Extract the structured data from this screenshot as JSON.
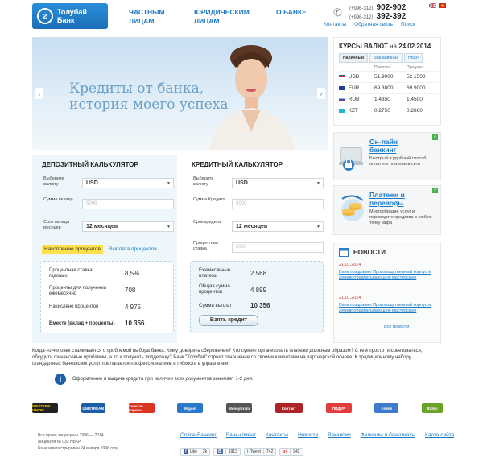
{
  "brand": {
    "name_line1": "Толубай",
    "name_line2": "Банк",
    "emblem": "coin-icon"
  },
  "topnav": [
    {
      "l1": "ЧАСТНЫМ",
      "l2": "ЛИЦАМ"
    },
    {
      "l1": "ЮРИДИЧЕСКИМ",
      "l2": "ЛИЦАМ"
    },
    {
      "l1": "О БАНКЕ",
      "l2": ""
    }
  ],
  "phones": [
    {
      "code": "(+996-312)",
      "number": "902-902"
    },
    {
      "code": "(+996-312)",
      "number": "392-392"
    }
  ],
  "toplinks": [
    "Контакты",
    "Обратная связь",
    "Поиск"
  ],
  "banner": {
    "line1": "Кредиты от банка,",
    "line2": "история моего успеха",
    "prev": "‹",
    "next": "›"
  },
  "rates": {
    "title": "КУРСЫ ВАЛЮТ",
    "date_prefix": "на",
    "date": "24.02.2014",
    "tabs": [
      "Наличный",
      "Безналичный",
      "НБКР"
    ],
    "headers": [
      "",
      "Покупка",
      "Продажа"
    ],
    "rows": [
      {
        "cur": "USD",
        "buy": "51.9000",
        "sell": "52.1500",
        "color": "#3a5fa8"
      },
      {
        "cur": "EUR",
        "buy": "69.3000",
        "sell": "69.9000",
        "color": "#1f3fa0"
      },
      {
        "cur": "RUB",
        "buy": "1.4350",
        "sell": "1.4500",
        "color": "#d22"
      },
      {
        "cur": "KZT",
        "buy": "0.2750",
        "sell": "0.2860",
        "color": "#29b0d8"
      }
    ]
  },
  "cards": [
    {
      "title1": "Он-лайн",
      "title2": "банкинг",
      "desc": "Быстрый и удобный способ оплатить платежи в сети"
    },
    {
      "title1": "Платежи и",
      "title2": "переводы",
      "desc": "Многообразие услуг и переводите средства в любую точку мира"
    }
  ],
  "news": {
    "title": "НОВОСТИ",
    "items": [
      {
        "date": "21.01.2014",
        "text": "Банк поздравил Производственный корпус и деревообрабатывающую мастерскую"
      },
      {
        "date": "21.01.2014",
        "text": "Банк поздравил Производственный корпус и деревообрабатывающую мастерскую"
      }
    ],
    "all": "Все новости"
  },
  "deposit": {
    "title": "ДЕПОЗИТНЫЙ КАЛЬКУЛЯТОР",
    "currency_label": "Выберите валюту",
    "currency": "USD",
    "amount_label": "Сумма вклада",
    "amount_placeholder": "5000",
    "term_label": "Срок вклада месяцев",
    "term": "12 месяцев",
    "tab_active": "Накопление процентов",
    "tab_other": "Выплата процентов",
    "results": [
      {
        "label": "Процентная ставка годовых",
        "value": "8,5%"
      },
      {
        "label": "Проценты для получения ежемесячно",
        "value": "708"
      },
      {
        "label": "Начислено процентов",
        "value": "4 975"
      },
      {
        "label": "Вместе (вклад + проценты)",
        "value": "10 356"
      }
    ]
  },
  "credit": {
    "title": "КРЕДИТНЫЙ КАЛЬКУЛЯТОР",
    "currency_label": "Выберите валюту",
    "currency": "USD",
    "amount_label": "Сумма Кредита",
    "amount_placeholder": "5000",
    "term_label": "Срок кредита",
    "term": "12 месяцев",
    "rate_label": "Процентная ставка",
    "rate_placeholder": "5000",
    "results": [
      {
        "label": "Ежемесячные платежи",
        "value": "2 568"
      },
      {
        "label": "Общая сумма процентов",
        "value": "4 899"
      },
      {
        "label": "Сумма выплат",
        "value": "10 356"
      }
    ],
    "button": "Взять кредит"
  },
  "about": "Когда-то человек сталкивается с проблемой выбора банка. Кому доверить сбережения? Кто сумеет организовать платежи должным образом? С кем просто посоветоваться, обсудить финансовые проблемы, а то и получить поддержку? Банк \"Толубай\" строит отношения со своими клиентами на партнерской основе. К традиционному набору стандартных банковских услуг прилагается профессионализм и гибкость в управлении.",
  "info": "Оформление и выдача кредита при наличии всех документов занимает 1-2 дня.",
  "partners": [
    {
      "name": "WESTERN UNION",
      "color": "#222"
    },
    {
      "name": "UNISTREAM",
      "color": "#1a5fa8"
    },
    {
      "name": "Золотая Корона",
      "color": "#d9341f"
    },
    {
      "name": "Migom",
      "color": "#2a78c9"
    },
    {
      "name": "MoneyGram",
      "color": "#555"
    },
    {
      "name": "Контакт",
      "color": "#ad2323"
    },
    {
      "name": "ЛИДЕР",
      "color": "#e23c3c"
    },
    {
      "name": "Anelik",
      "color": "#3b7ccc"
    },
    {
      "name": "Blizko",
      "color": "#6aa22a"
    }
  ],
  "copyright": [
    "Все права защищены 1996 — 2014",
    "Лицензия № 032 НБКР",
    "Банк зарегистрирован 24 января 1996 года"
  ],
  "footnav": [
    "Online-Банкинг",
    "Банк-клиент",
    "Контакты",
    "Новости",
    "Вакансии",
    "Филиалы и банкоматы",
    "Карта сайта"
  ],
  "social": [
    {
      "brand": "f",
      "label": "Like",
      "count": "2k"
    },
    {
      "brand": "",
      "label": "",
      "count": "1913"
    },
    {
      "brand": "t",
      "label": "Tweet",
      "count": "742"
    },
    {
      "brand": "",
      "label": "",
      "count": "942"
    }
  ]
}
